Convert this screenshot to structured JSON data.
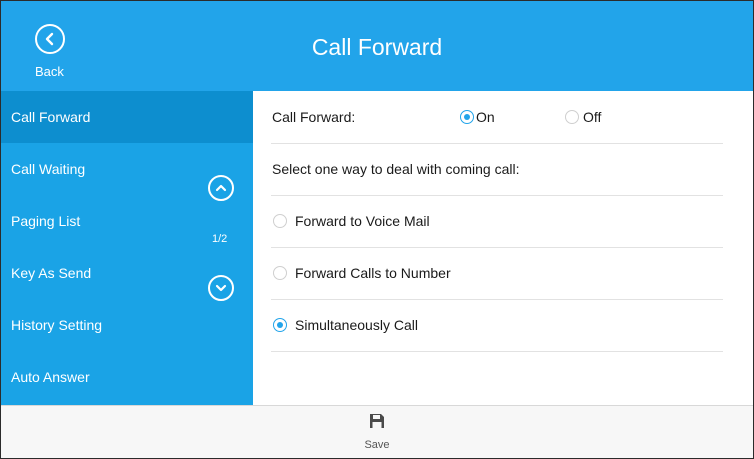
{
  "header": {
    "title": "Call Forward",
    "back_label": "Back",
    "back_icon": "chevron-left-icon"
  },
  "sidebar": {
    "items": [
      {
        "label": "Call Forward",
        "active": true
      },
      {
        "label": "Call Waiting",
        "active": false
      },
      {
        "label": "Paging List",
        "active": false
      },
      {
        "label": "Key As Send",
        "active": false
      },
      {
        "label": "History Setting",
        "active": false
      },
      {
        "label": "Auto Answer",
        "active": false
      }
    ],
    "page_indicator": "1/2",
    "scroll_up_icon": "chevron-up-icon",
    "scroll_down_icon": "chevron-down-icon"
  },
  "content": {
    "call_forward_label": "Call Forward:",
    "on_label": "On",
    "off_label": "Off",
    "call_forward_state": "On",
    "instruction": "Select one way to deal with coming call:",
    "options": [
      {
        "label": "Forward to Voice Mail",
        "selected": false
      },
      {
        "label": "Forward Calls to Number",
        "selected": false
      },
      {
        "label": "Simultaneously Call",
        "selected": true
      }
    ]
  },
  "footer": {
    "save_label": "Save",
    "save_icon": "floppy-disk-icon"
  },
  "colors": {
    "header_bg": "#22a4ea",
    "sidebar_bg": "#1aa3e6",
    "active_item_bg": "#0d8ecf",
    "accent": "#22a4ea"
  }
}
